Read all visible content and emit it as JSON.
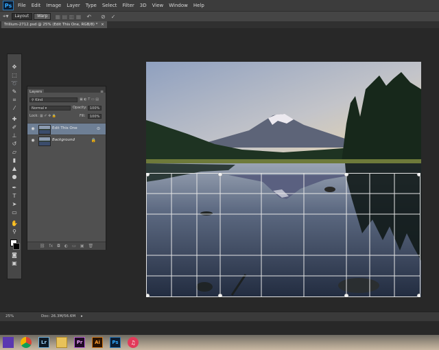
{
  "app": {
    "logo": "Ps"
  },
  "menu": [
    "File",
    "Edit",
    "Image",
    "Layer",
    "Type",
    "Select",
    "Filter",
    "3D",
    "View",
    "Window",
    "Help"
  ],
  "options": {
    "layout_label": "Layout",
    "warp_label": "Warp",
    "icons": [
      "transform-icon",
      "undo-icon",
      "cancel-icon",
      "commit-icon"
    ]
  },
  "document": {
    "tab_title": "Trillium-2712.psd @ 25% (Edit This One, RGB/8) *"
  },
  "layers_panel": {
    "tab_label": "Layers",
    "kind_label": "Kind",
    "blend_mode": "Normal",
    "opacity_label": "Opacity:",
    "opacity_value": "100%",
    "lock_label": "Lock:",
    "fill_label": "Fill:",
    "fill_value": "100%",
    "layers": [
      {
        "name": "Edit This One",
        "selected": true
      },
      {
        "name": "Background",
        "selected": false,
        "locked": true
      }
    ]
  },
  "status": {
    "zoom": "25%",
    "doc_info": "Doc: 26.3M/56.6M"
  },
  "taskbar": {
    "apps": [
      {
        "label": "",
        "name": "start-icon"
      },
      {
        "label": "",
        "name": "chrome-icon"
      },
      {
        "label": "Lr",
        "name": "lightroom-icon"
      },
      {
        "label": "",
        "name": "file-explorer-icon"
      },
      {
        "label": "Pr",
        "name": "premiere-icon"
      },
      {
        "label": "Ai",
        "name": "illustrator-icon"
      },
      {
        "label": "Ps",
        "name": "photoshop-icon"
      },
      {
        "label": "",
        "name": "itunes-icon"
      }
    ]
  },
  "colors": {
    "selection": "#6e7f95",
    "ps_blue": "#30a8ff"
  }
}
